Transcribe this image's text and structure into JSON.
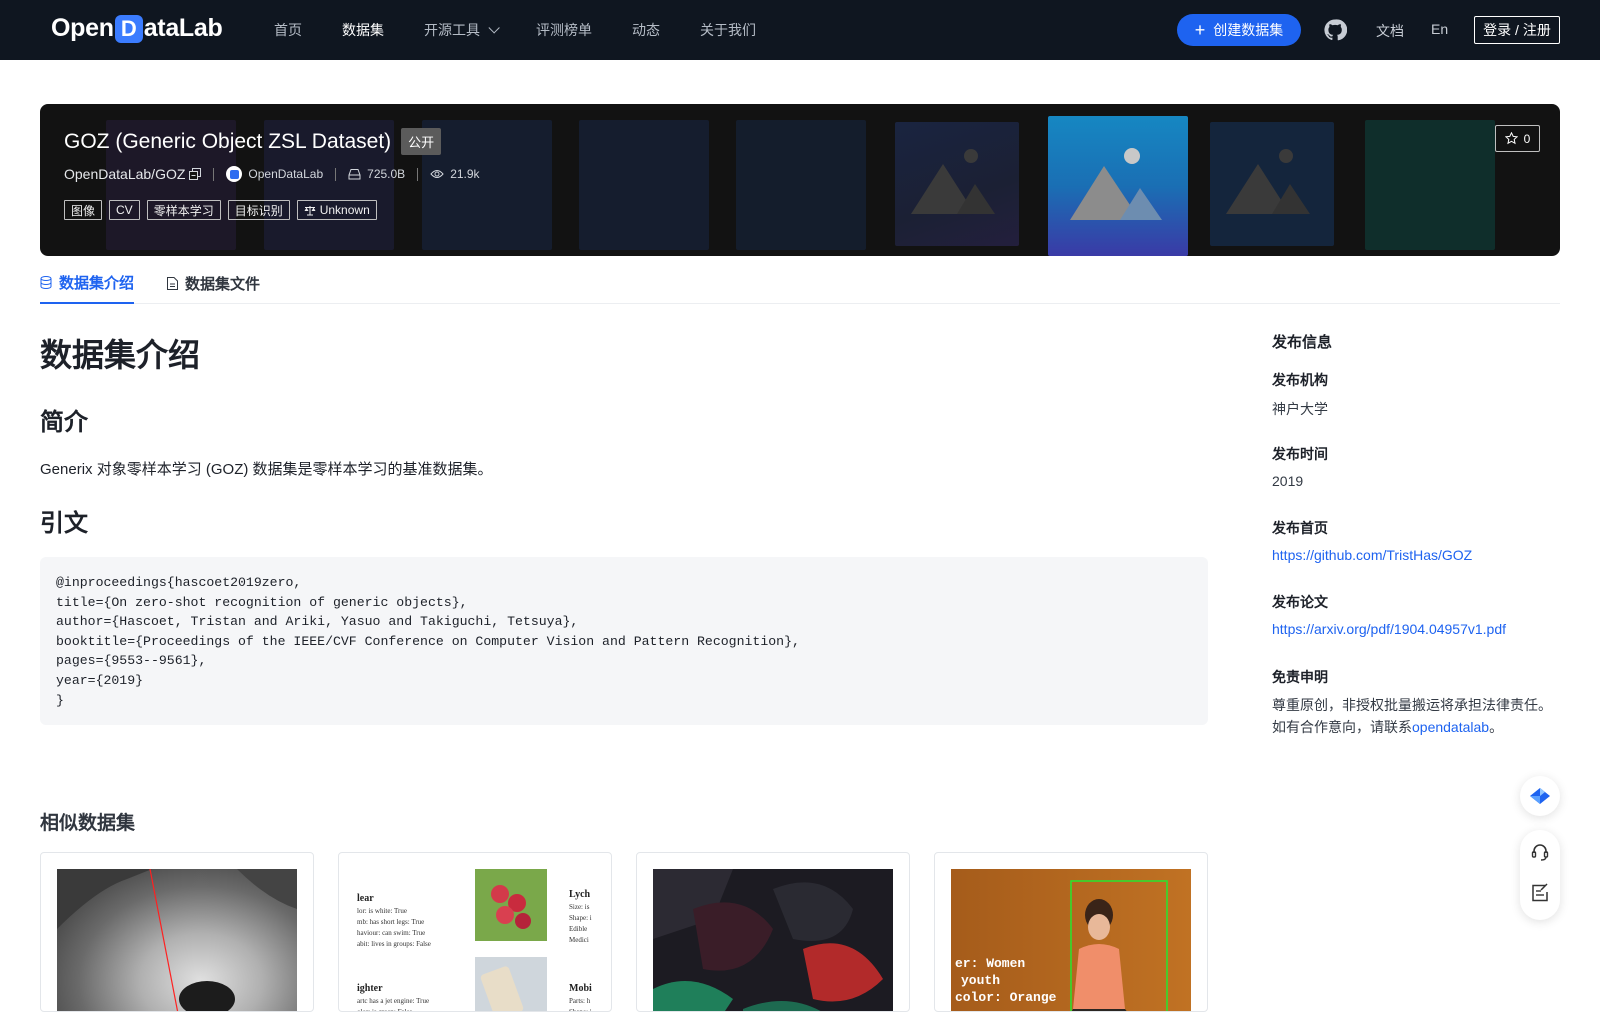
{
  "nav": {
    "logo_text_1": "Open",
    "logo_text_d": "D",
    "logo_text_2": "ataLab",
    "links": [
      {
        "label": "首页"
      },
      {
        "label": "数据集"
      },
      {
        "label": "开源工具"
      },
      {
        "label": "评测榜单"
      },
      {
        "label": "动态"
      },
      {
        "label": "关于我们"
      }
    ],
    "create_label": "创建数据集",
    "docs_label": "文档",
    "lang_label": "En",
    "login_label": "登录 / 注册"
  },
  "hero": {
    "title": "GOZ (Generic Object ZSL Dataset)",
    "visibility": "公开",
    "repo": "OpenDataLab/GOZ",
    "org": "OpenDataLab",
    "size": "725.0B",
    "views": "21.9k",
    "tags": [
      "图像",
      "CV",
      "零样本学习",
      "目标识别"
    ],
    "license": "Unknown",
    "stars": "0"
  },
  "tabs": [
    {
      "label": "数据集介绍"
    },
    {
      "label": "数据集文件"
    }
  ],
  "content": {
    "heading": "数据集介绍",
    "intro_heading": "简介",
    "intro_text": "Generix 对象零样本学习 (GOZ) 数据集是零样本学习的基准数据集。",
    "citation_heading": "引文",
    "citation": "@inproceedings{hascoet2019zero,\ntitle={On zero-shot recognition of generic objects},\nauthor={Hascoet, Tristan and Ariki, Yasuo and Takiguchi, Tetsuya},\nbooktitle={Proceedings of the IEEE/CVF Conference on Computer Vision and Pattern Recognition},\npages={9553--9561},\nyear={2019}\n}"
  },
  "sidebar": {
    "title": "发布信息",
    "org_label": "发布机构",
    "org_value": "神户大学",
    "time_label": "发布时间",
    "time_value": "2019",
    "home_label": "发布首页",
    "home_value": "https://github.com/TristHas/GOZ",
    "paper_label": "发布论文",
    "paper_value": "https://arxiv.org/pdf/1904.04957v1.pdf",
    "disclaimer_label": "免责申明",
    "disclaimer_line1": "尊重原创，非授权批量搬运将承担法律责任。",
    "disclaimer_line2_prefix": "如有合作意向，请联系",
    "disclaimer_link": "opendatalab",
    "disclaimer_line2_suffix": "。"
  },
  "similar": {
    "title": "相似数据集",
    "card3_text_1": "er: Women",
    "card3_text_2": "youth",
    "card3_text_3": "color: Orange"
  },
  "icons": {
    "plus": "plus-icon",
    "github": "github-icon",
    "copy": "copy-icon",
    "storage": "storage-icon",
    "eye": "eye-icon",
    "scale": "scale-icon",
    "star": "star-icon",
    "database": "database-icon",
    "file": "file-icon",
    "headset": "headset-icon",
    "feedback": "feedback-icon"
  },
  "colors": {
    "nav_bg": "#0f1620",
    "accent": "#1e63f0",
    "hero_bg": "#121212"
  }
}
